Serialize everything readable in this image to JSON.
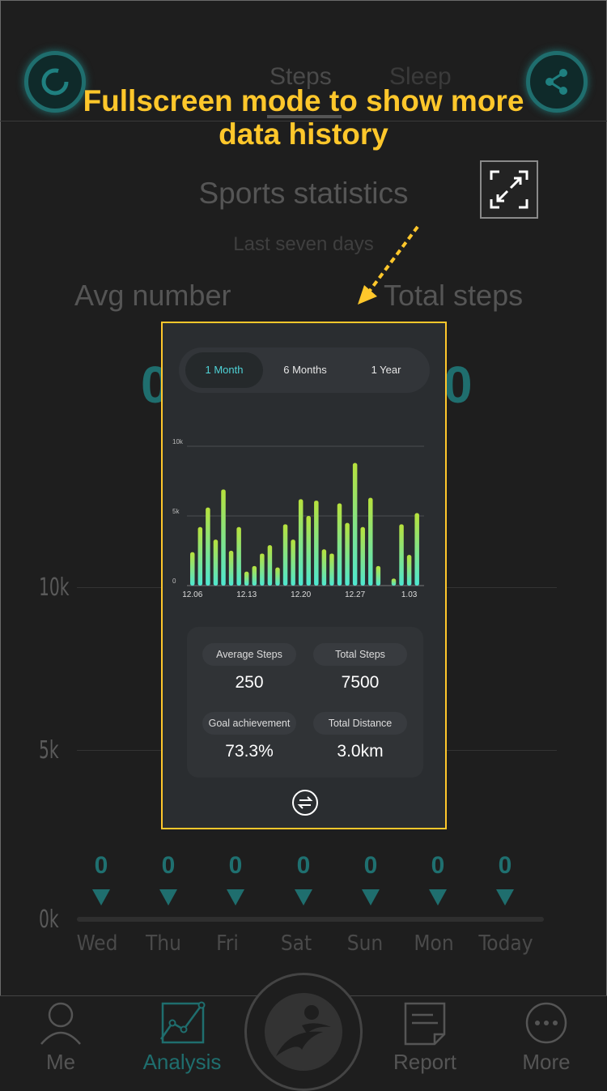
{
  "header": {
    "tabs": [
      {
        "label": "Steps"
      },
      {
        "label": "Sleep"
      }
    ],
    "left_icon": "sync-icon",
    "right_icon": "share-icon"
  },
  "callout": {
    "line1": "Fullscreen mode to show more",
    "line2": "data history",
    "color": "#ffc72b"
  },
  "main": {
    "title": "Sports statistics",
    "subtitle": "Last seven days",
    "avg_label": "Avg number",
    "total_label": "Total steps",
    "avg_value": "0",
    "total_value": "0"
  },
  "background_chart": {
    "y_labels": [
      "10k",
      "5k",
      "0k"
    ],
    "days": [
      {
        "label": "Wed",
        "value": "0"
      },
      {
        "label": "Thu",
        "value": "0"
      },
      {
        "label": "Fri",
        "value": "0"
      },
      {
        "label": "Sat",
        "value": "0"
      },
      {
        "label": "Sun",
        "value": "0"
      },
      {
        "label": "Mon",
        "value": "0"
      },
      {
        "label": "Today",
        "value": "0"
      }
    ]
  },
  "popup": {
    "segments": [
      {
        "label": "1 Month",
        "active": true
      },
      {
        "label": "6 Months",
        "active": false
      },
      {
        "label": "1 Year",
        "active": false
      }
    ],
    "stats": [
      {
        "label": "Average Steps",
        "value": "250"
      },
      {
        "label": "Total Steps",
        "value": "7500"
      },
      {
        "label": "Goal achievement",
        "value": "73.3%"
      },
      {
        "label": "Total Distance",
        "value": "3.0km"
      }
    ],
    "swap_icon": "swap-icon"
  },
  "chart_data": {
    "type": "bar",
    "ytick_labels": [
      "0",
      "5k",
      "10k"
    ],
    "xtick_labels": [
      "12.06",
      "12.13",
      "12.20",
      "12.27",
      "1.03"
    ],
    "ylim": [
      0,
      10000
    ],
    "values": [
      2400,
      4200,
      5600,
      3300,
      6900,
      2500,
      4200,
      1000,
      1400,
      2300,
      2900,
      1300,
      4400,
      3300,
      6200,
      5000,
      6100,
      2600,
      2300,
      5900,
      4500,
      8800,
      4200,
      6300,
      1400,
      0,
      500,
      4400,
      2200,
      5200
    ],
    "gradient": [
      "#4ee6d0",
      "#b7e13c"
    ]
  },
  "bottom_nav": [
    {
      "label": "Me",
      "icon": "person-icon"
    },
    {
      "label": "Analysis",
      "icon": "chart-icon"
    },
    {
      "label": "Report",
      "icon": "report-icon"
    },
    {
      "label": "More",
      "icon": "more-icon"
    }
  ],
  "colors": {
    "accent": "#1f6e6e",
    "active_nav": "#1f6e6e",
    "highlight": "#ffc72b"
  }
}
